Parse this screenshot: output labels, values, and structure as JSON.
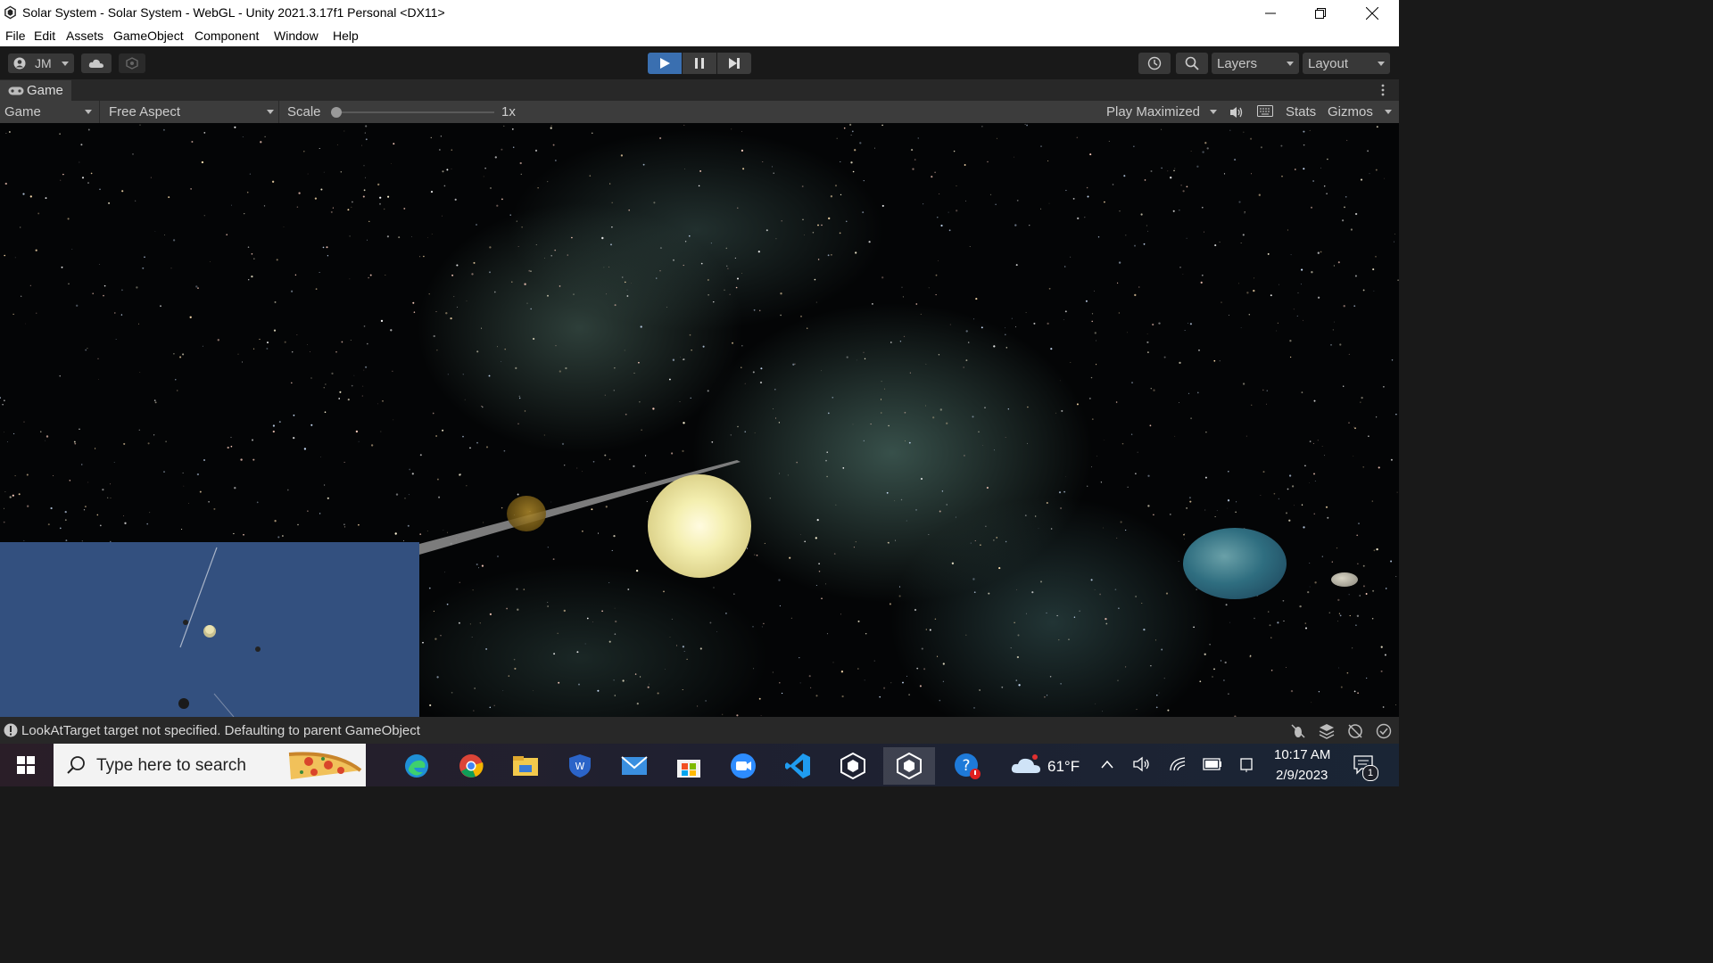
{
  "window": {
    "title": "Solar System - Solar System - WebGL - Unity 2021.3.17f1 Personal <DX11>"
  },
  "menu": [
    "File",
    "Edit",
    "Assets",
    "GameObject",
    "Component",
    "Window",
    "Help"
  ],
  "toolbar": {
    "account_label": "JM",
    "layers_label": "Layers",
    "layout_label": "Layout"
  },
  "game_tab": {
    "label": "Game"
  },
  "game_controls": {
    "display": "Game",
    "aspect": "Free Aspect",
    "scale_label": "Scale",
    "scale_value": "1x",
    "play_mode": "Play Maximized",
    "stats_label": "Stats",
    "gizmos_label": "Gizmos"
  },
  "console": {
    "message": "LookAtTarget target not specified. Defaulting to parent GameObject"
  },
  "taskbar": {
    "search_placeholder": "Type here to search",
    "weather": "61°F",
    "time": "10:17 AM",
    "date": "2/9/2023",
    "notification_count": "1"
  },
  "colors": {
    "editor_bg": "#191919",
    "panel_bg": "#3c3c3c",
    "minimap_bg": "#33507f",
    "sun": "#f5f0b0"
  },
  "icons": [
    "unity-icon",
    "minimize-icon",
    "restore-icon",
    "close-icon",
    "account-icon",
    "cloud-icon",
    "collab-icon",
    "play-icon",
    "pause-icon",
    "step-icon",
    "history-icon",
    "search-icon",
    "gamepad-icon",
    "more-icon",
    "mute-icon",
    "keyboard-icon",
    "info-icon",
    "windows-start-icon"
  ]
}
